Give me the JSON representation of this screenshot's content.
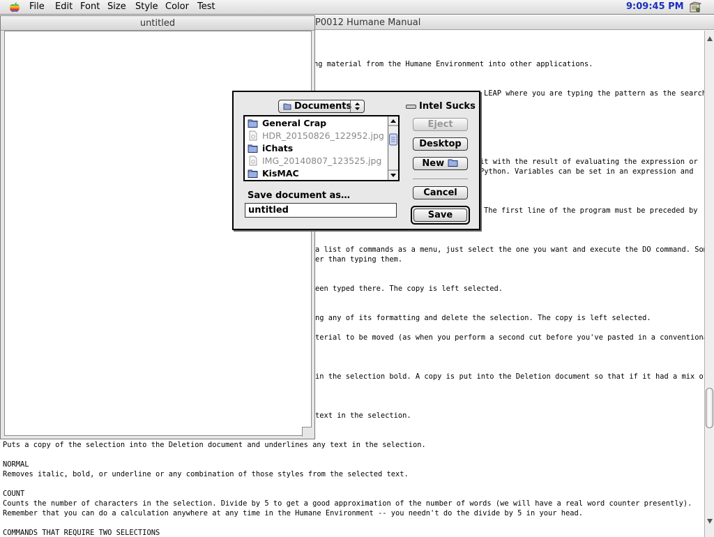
{
  "menubar": {
    "items": [
      "File",
      "Edit",
      "Font",
      "Size",
      "Style",
      "Color",
      "Test"
    ],
    "clock": "9:09:45 PM",
    "apple_icon": "apple-icon",
    "app_icon": "application-menu-icon"
  },
  "manual_window": {
    "title": "P0012 Humane Manual",
    "lines": [
      "ng material from the Humane Environment into other applications.",
      "LEAP where you are typing the pattern as the search",
      "it with the result of evaluating the expression or",
      "Python. Variables can be set in an expression and",
      "The first line of the program must be preceded by",
      "a list of commands as a menu, just select the one you want and execute the DO command. Some",
      "er than typing them.",
      "een typed there. The copy is left selected.",
      "ng any of its formatting and delete the selection. The copy is left selected.",
      "terial to be moved (as when you perform a second cut before you've pasted in a conventional",
      "in the selection bold. A copy is put into the Deletion document so that if it had a mix of",
      "text in the selection.",
      "Puts a copy of the selection into the Deletion document and underlines any text in the selection.",
      "NORMAL",
      "Removes italic, bold, or underline or any combination of those styles from the selected text.",
      "COUNT",
      "Counts the number of characters in the selection. Divide by 5 to get a good approximation of the number of words (we will have a real word counter presently).",
      "Remember that you can do a calculation anywhere at any time in the Humane Environment -- you needn't do the divide by 5 in your head.",
      "COMMANDS THAT REQUIRE TWO SELECTIONS"
    ]
  },
  "untitled_window": {
    "title": "untitled"
  },
  "save_dialog": {
    "location_popup": "Documents",
    "disk_name": "Intel Sucks",
    "files": [
      {
        "name": "General Crap",
        "kind": "folder"
      },
      {
        "name": "HDR_20150826_122952.jpg",
        "kind": "document"
      },
      {
        "name": "iChats",
        "kind": "folder"
      },
      {
        "name": "IMG_20140807_123525.jpg",
        "kind": "document"
      },
      {
        "name": "KisMAC",
        "kind": "folder"
      }
    ],
    "eject_label": "Eject",
    "desktop_label": "Desktop",
    "new_label": "New",
    "cancel_label": "Cancel",
    "save_label": "Save",
    "save_as_label": "Save document as…",
    "filename_value": "untitled"
  },
  "colors": {
    "clock": "#1a2fbf",
    "disabled_text": "#888888"
  }
}
